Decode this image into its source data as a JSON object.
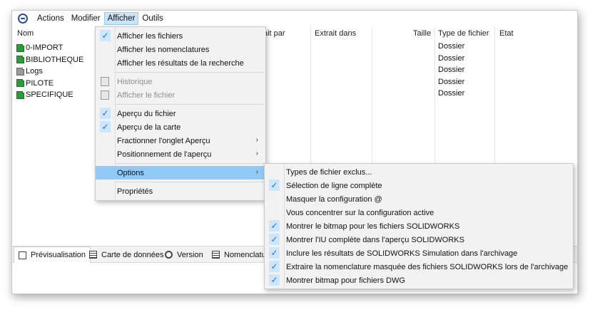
{
  "menubar": {
    "items": [
      "Actions",
      "Modifier",
      "Afficher",
      "Outils"
    ]
  },
  "columns": {
    "nom": "Nom",
    "fait_par": "ait par",
    "extrait_dans": "Extrait dans",
    "taille": "Taille",
    "type": "Type de fichier",
    "etat": "Etat"
  },
  "tree": [
    {
      "label": "0-IMPORT",
      "type": "Dossier",
      "icon": "green-folder-icon"
    },
    {
      "label": "BIBLIOTHEQUE",
      "type": "Dossier",
      "icon": "green-folder-icon"
    },
    {
      "label": "Logs",
      "type": "Dossier",
      "icon": "gray-folder-icon"
    },
    {
      "label": "PILOTE",
      "type": "Dossier",
      "icon": "green-folder-icon"
    },
    {
      "label": "SPECIFIQUE",
      "type": "Dossier",
      "icon": "green-folder-icon"
    }
  ],
  "tabs": [
    "Prévisualisation",
    "Carte de données",
    "Version",
    "Nomenclatur"
  ],
  "afficher_menu": {
    "afficher_fichiers": "Afficher les fichiers",
    "afficher_nomenclatures": "Afficher les nomenclatures",
    "afficher_resultats": "Afficher les résultats de la recherche",
    "historique": "Historique",
    "afficher_fichier": "Afficher le fichier",
    "apercu_fichier": "Aperçu du fichier",
    "apercu_carte": "Aperçu de la carte",
    "fractionner": "Fractionner l'onglet Aperçu",
    "positionnement": "Positionnement de l'aperçu",
    "options": "Options",
    "proprietes": "Propriétés"
  },
  "options_menu": {
    "types_exclus": "Types de fichier exclus...",
    "selection_ligne": "Sélection de ligne complète",
    "masquer_config": "Masquer la configuration @",
    "concentrer_config": "Vous concentrer sur la configuration active",
    "bitmap_solidworks": "Montrer le bitmap pour les fichiers SOLIDWORKS",
    "iu_complete": "Montrer l'IU complète dans l'aperçu SOLIDWORKS",
    "resultats_simulation": "Inclure les résultats de SOLIDWORKS Simulation dans l'archivage",
    "nomenclature_masquee": "Extraire la nomenclature masquée des fichiers SOLIDWORKS lors de l'archivage",
    "bitmap_dwg": "Montrer bitmap pour fichiers DWG"
  },
  "colors": {
    "highlight": "#91c9f7",
    "check": "#1f6fd0",
    "folder_green": "#2c9b3b"
  }
}
